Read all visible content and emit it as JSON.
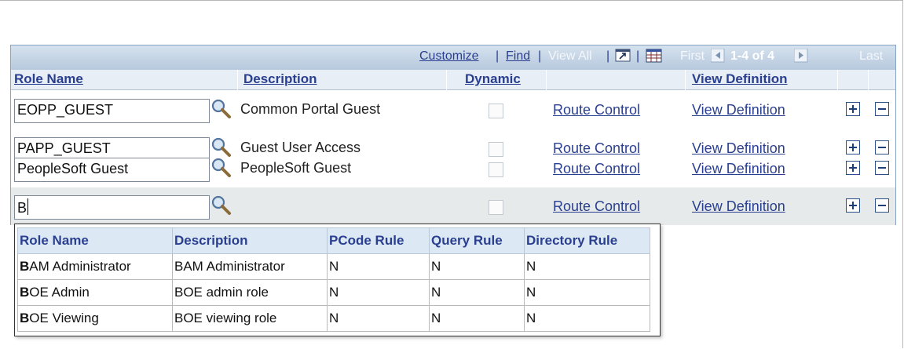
{
  "toolbar": {
    "customize": "Customize",
    "find": "Find",
    "view_all": "View All",
    "first": "First",
    "range": "1-4 of 4",
    "last": "Last",
    "separator": "|"
  },
  "columns": {
    "role_name": "Role Name",
    "description": "Description",
    "dynamic": "Dynamic",
    "view_definition": "View Definition"
  },
  "rows": [
    {
      "role": "EOPP_GUEST",
      "description": "Common Portal Guest",
      "route": "Route Control",
      "view": "View Definition"
    },
    {
      "role": "PAPP_GUEST",
      "description": "Guest User Access",
      "route": "Route Control",
      "view": "View Definition"
    },
    {
      "role": "PeopleSoft Guest",
      "description": "PeopleSoft Guest",
      "route": "Route Control",
      "view": "View Definition"
    },
    {
      "role": "B",
      "description": "",
      "route": "Route Control",
      "view": "View Definition"
    }
  ],
  "prompt": {
    "headers": [
      "Role Name",
      "Description",
      "PCode Rule",
      "Query Rule",
      "Directory Rule"
    ],
    "rows": [
      {
        "match": "B",
        "rest": "AM Administrator",
        "description": "BAM Administrator",
        "pcode": "N",
        "query": "N",
        "directory": "N"
      },
      {
        "match": "B",
        "rest": "OE Admin",
        "description": "BOE admin role",
        "pcode": "N",
        "query": "N",
        "directory": "N"
      },
      {
        "match": "B",
        "rest": "OE Viewing",
        "description": "BOE viewing role",
        "pcode": "N",
        "query": "N",
        "directory": "N"
      }
    ]
  },
  "icons": [
    "download-icon",
    "spreadsheet-icon",
    "first-arrow-icon",
    "last-arrow-icon",
    "magnifier-icon",
    "add-row-icon",
    "delete-row-icon"
  ],
  "colors": {
    "link": "#2a3f8f",
    "header_bg": "#b7c9dd",
    "alt_row": "#e6eaea"
  }
}
